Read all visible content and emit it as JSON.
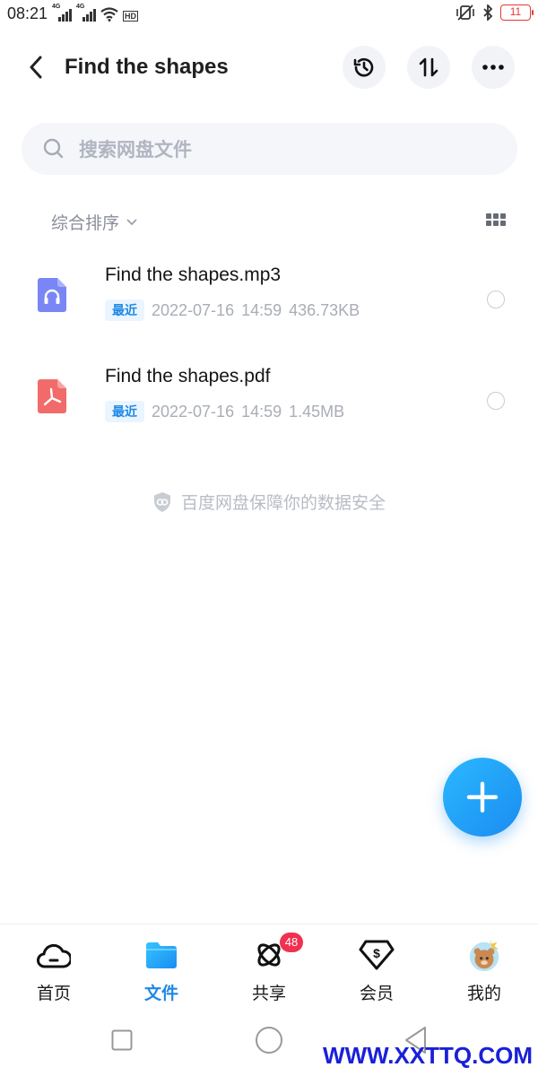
{
  "status_bar": {
    "time": "08:21",
    "signal1_tag": "4G",
    "signal2_tag": "4G",
    "hd_label": "HD",
    "battery_level": "11",
    "battery_color": "#e53935"
  },
  "header": {
    "title": "Find the shapes",
    "back_icon": "chevron-left-icon",
    "buttons": [
      "history-icon",
      "transfer-icon",
      "more-icon"
    ]
  },
  "search": {
    "placeholder": "搜索网盘文件"
  },
  "sort": {
    "label": "综合排序"
  },
  "files": [
    {
      "name": "Find the shapes.mp3",
      "icon": "audio-file-icon",
      "badge": "最近",
      "date": "2022-07-16",
      "time": "14:59",
      "size": "436.73KB"
    },
    {
      "name": "Find the shapes.pdf",
      "icon": "pdf-file-icon",
      "badge": "最近",
      "date": "2022-07-16",
      "time": "14:59",
      "size": "1.45MB"
    }
  ],
  "safety_note": "百度网盘保障你的数据安全",
  "bottom_nav": [
    {
      "label": "首页",
      "icon": "cloud-home-icon",
      "active": false
    },
    {
      "label": "文件",
      "icon": "folder-icon",
      "active": true
    },
    {
      "label": "共享",
      "icon": "planet-share-icon",
      "active": false,
      "badge": "48"
    },
    {
      "label": "会员",
      "icon": "vip-diamond-icon",
      "active": false
    },
    {
      "label": "我的",
      "icon": "avatar-icon",
      "active": false
    }
  ],
  "accent_color": "#1e88e5",
  "watermark": "WWW.XXTTQ.COM"
}
